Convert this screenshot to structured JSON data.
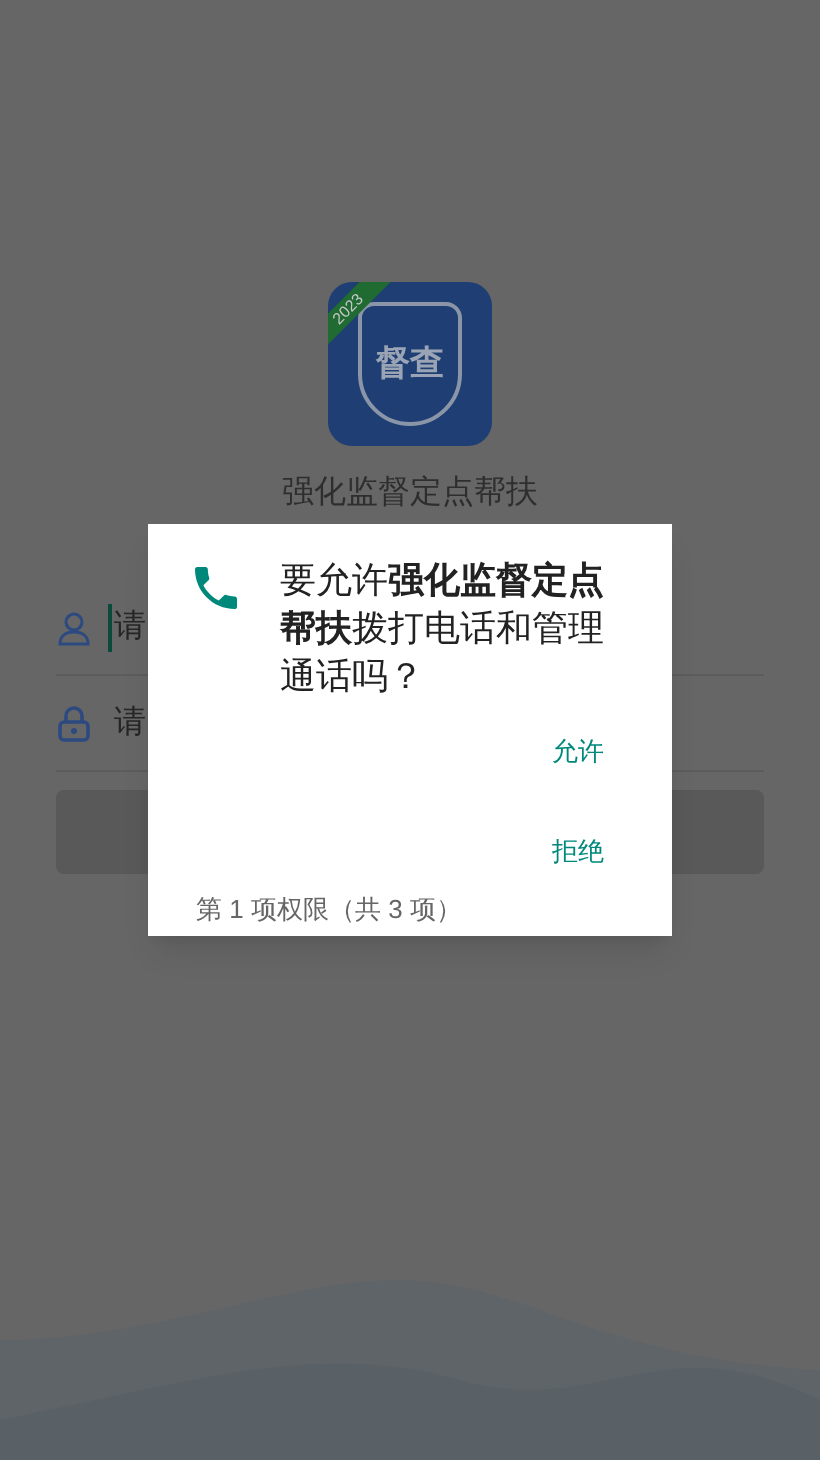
{
  "app": {
    "badge_year": "2023",
    "logo_text": "督查",
    "title": "强化监督定点帮扶"
  },
  "fields": [
    {
      "kind": "user",
      "placeholder": "请",
      "focused": true
    },
    {
      "kind": "lock",
      "placeholder": "请",
      "focused": false
    }
  ],
  "dialog": {
    "message": "要允许**强化监督定点帮扶**拨打电话和管理通话吗？",
    "buttons": [
      "允许",
      "拒绝"
    ],
    "footer": "第 1 项权限（共 3 项）"
  }
}
